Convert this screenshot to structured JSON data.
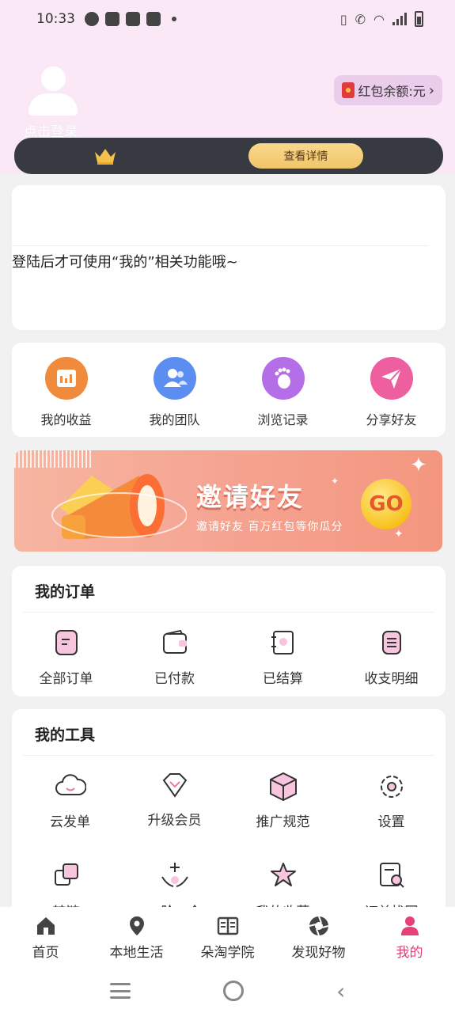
{
  "status_bar": {
    "time": "10:33"
  },
  "header": {
    "login_label": "点击登录",
    "red_packet_label": "红包余额:元",
    "red_packet_chevron": "›",
    "vip_button_label": "查看详情"
  },
  "login_card": {
    "message": "登陆后才可使用“我的”相关功能哦~"
  },
  "quick_actions": [
    {
      "label": "我的收益",
      "icon": "calendar-icon",
      "color": "#f08a3c"
    },
    {
      "label": "我的团队",
      "icon": "team-icon",
      "color": "#5b8ef0"
    },
    {
      "label": "浏览记录",
      "icon": "footprint-icon",
      "color": "#b46ee8"
    },
    {
      "label": "分享好友",
      "icon": "share-icon",
      "color": "#ee5f9f"
    }
  ],
  "banner": {
    "title": "邀请好友",
    "subtitle": "邀请好友 百万红包等你瓜分",
    "go_label": "GO"
  },
  "orders": {
    "title": "我的订单",
    "items": [
      {
        "label": "全部订单",
        "icon": "all-orders-icon"
      },
      {
        "label": "已付款",
        "icon": "wallet-icon"
      },
      {
        "label": "已结算",
        "icon": "settled-icon"
      },
      {
        "label": "收支明细",
        "icon": "ledger-icon"
      }
    ]
  },
  "tools": {
    "title": "我的工具",
    "row1": [
      {
        "label": "云发单",
        "icon": "cloud-icon"
      },
      {
        "label": "升级会员",
        "icon": "diamond-icon"
      },
      {
        "label": "推广规范",
        "icon": "box-icon"
      },
      {
        "label": "设置",
        "icon": "gear-icon"
      }
    ],
    "row2": [
      {
        "label": "转链",
        "icon": "convert-link-icon"
      },
      {
        "label": "二阶一今",
        "icon": "hands-plus-icon"
      },
      {
        "label": "我的收藏",
        "icon": "star-icon"
      },
      {
        "label": "订单找回",
        "icon": "order-search-icon"
      }
    ]
  },
  "bottom_nav": [
    {
      "label": "首页",
      "icon": "home-icon"
    },
    {
      "label": "本地生活",
      "icon": "location-icon"
    },
    {
      "label": "朵淘学院",
      "icon": "book-icon"
    },
    {
      "label": "发现好物",
      "icon": "aperture-icon"
    },
    {
      "label": "我的",
      "icon": "user-icon",
      "active": true
    }
  ],
  "colors": {
    "accent": "#e83e7a",
    "header_bg": "#fbe8f7",
    "vip_bar": "#383a42",
    "vip_button": "#f3cd7a"
  }
}
